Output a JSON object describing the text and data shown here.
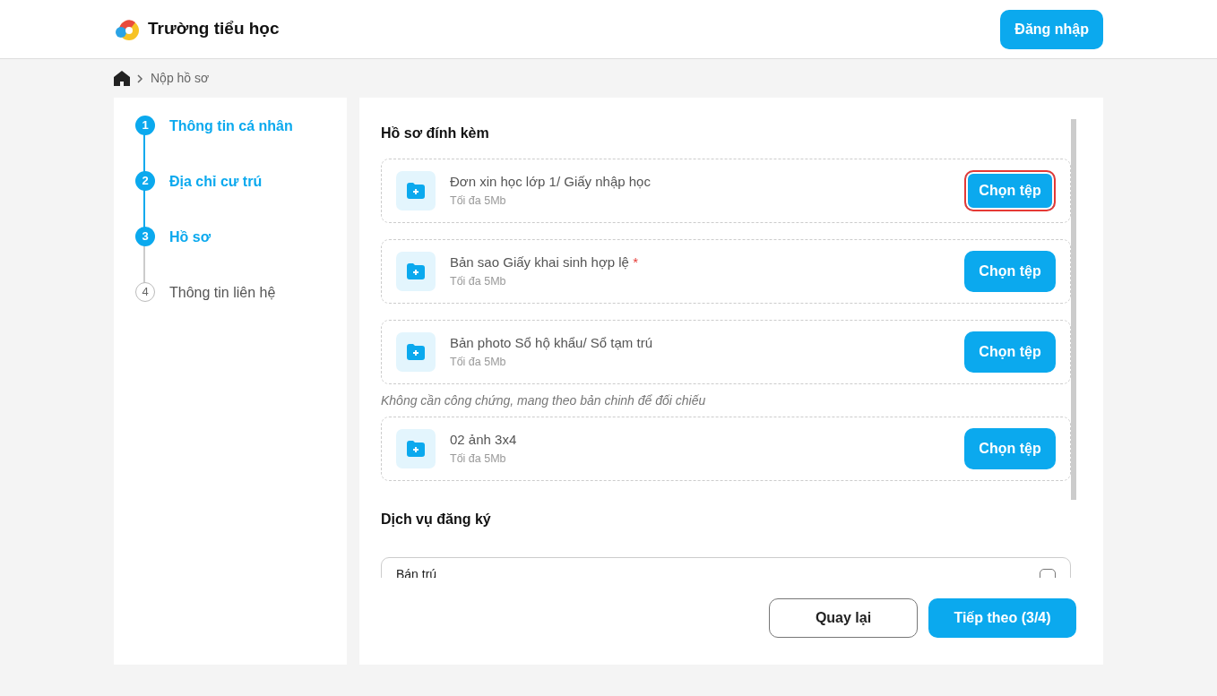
{
  "header": {
    "school_name": "Trường tiểu học",
    "login_button": "Đăng nhập"
  },
  "breadcrumb": {
    "current": "Nộp hồ sơ"
  },
  "steps": [
    {
      "number": "1",
      "label": "Thông tin cá nhân",
      "reached": true
    },
    {
      "number": "2",
      "label": "Địa chỉ cư trú",
      "reached": true
    },
    {
      "number": "3",
      "label": "Hồ sơ",
      "reached": true
    },
    {
      "number": "4",
      "label": "Thông tin liên hệ",
      "reached": false
    }
  ],
  "attachments": {
    "title": "Hồ sơ đính kèm",
    "items": [
      {
        "kind": "file",
        "label": "Đơn xin học lớp 1/ Giấy nhập học",
        "hint": "Tối đa 5Mb",
        "button": "Chọn tệp",
        "highlighted": true
      },
      {
        "kind": "file",
        "label": "Bản sao Giấy khai sinh hợp lệ",
        "required_mark": "*",
        "hint": "Tối đa 5Mb",
        "button": "Chọn tệp",
        "highlighted": false
      },
      {
        "kind": "file",
        "label": "Bản photo Sổ hộ khẩu/ Sổ tạm trú",
        "hint": "Tối đa 5Mb",
        "button": "Chọn tệp",
        "highlighted": false
      },
      {
        "kind": "note",
        "text": "Không cần công chứng, mang theo bản chinh để đối chiếu"
      },
      {
        "kind": "file",
        "label": "02 ảnh 3x4",
        "hint": "Tối đa 5Mb",
        "button": "Chọn tệp",
        "highlighted": false
      }
    ]
  },
  "services": {
    "title": "Dịch vụ đăng ký",
    "options": [
      {
        "label": "Bán trú",
        "checked": false
      }
    ]
  },
  "footer": {
    "back_button": "Quay lại",
    "next_button": "Tiếp theo (3/4)"
  }
}
